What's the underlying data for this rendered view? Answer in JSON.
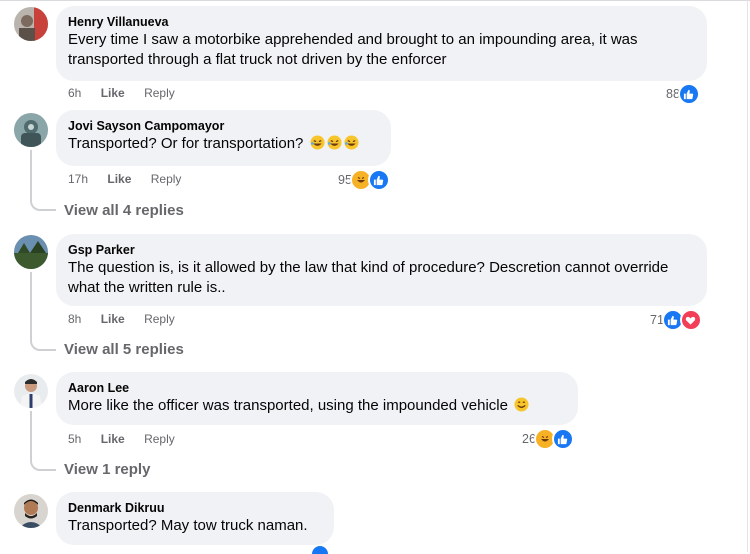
{
  "comments": [
    {
      "author": "Henry Villanueva",
      "text": "Every time I saw a motorbike apprehended and brought to an impounding area, it was transported through a flat truck not driven by the enforcer",
      "time": "6h",
      "like_label": "Like",
      "reply_label": "Reply",
      "reaction_count": "88",
      "reactions": [
        "like"
      ]
    },
    {
      "author": "Jovi Sayson Campomayor",
      "text": "Transported? Or for transportation?",
      "emojis": [
        "rolling-laugh",
        "rolling-laugh",
        "rolling-laugh"
      ],
      "time": "17h",
      "like_label": "Like",
      "reply_label": "Reply",
      "reaction_count": "95",
      "reactions": [
        "haha",
        "like"
      ],
      "view_replies": "View all 4 replies"
    },
    {
      "author": "Gsp Parker",
      "text": "The question is, is it allowed by the law that kind of procedure? Descretion cannot override what the written rule is..",
      "time": "8h",
      "like_label": "Like",
      "reply_label": "Reply",
      "reaction_count": "71",
      "reactions": [
        "like",
        "love"
      ],
      "view_replies": "View all 5 replies"
    },
    {
      "author": "Aaron Lee",
      "text": "More like the officer was transported, using the impounded vehicle",
      "emojis": [
        "smile"
      ],
      "time": "5h",
      "like_label": "Like",
      "reply_label": "Reply",
      "reaction_count": "26",
      "reactions": [
        "haha",
        "like"
      ],
      "view_replies": "View 1 reply"
    },
    {
      "author": "Denmark Dikruu",
      "text": "Transported? May tow truck naman."
    }
  ],
  "colors": {
    "bubble": "#f0f2f5",
    "meta_text": "#65676b",
    "like_blue": "#1877f2",
    "love_red": "#f33e58",
    "haha_yellow": "#f7b125"
  }
}
